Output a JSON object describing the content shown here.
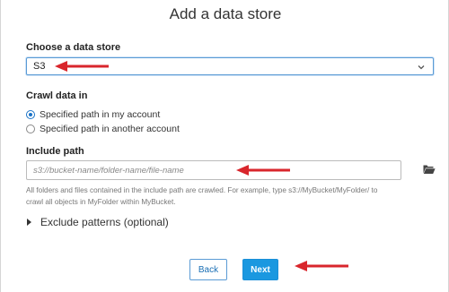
{
  "dialog": {
    "title": "Add a data store"
  },
  "data_store": {
    "label": "Choose a data store",
    "selected": "S3",
    "icons": {
      "dropdown": "chevron-down-icon"
    }
  },
  "crawl": {
    "label": "Crawl data in",
    "options": [
      {
        "label": "Specified path in my account",
        "checked": true
      },
      {
        "label": "Specified path in another account",
        "checked": false
      }
    ]
  },
  "include_path": {
    "label": "Include path",
    "placeholder": "s3://bucket-name/folder-name/file-name",
    "value": "",
    "help_line1": "All folders and files contained in the include path are crawled. For example, type s3://MyBucket/MyFolder/ to",
    "help_line2": "crawl all objects in MyFolder within MyBucket.",
    "icons": {
      "browse": "folder-open-icon"
    }
  },
  "exclude": {
    "label": "Exclude patterns (optional)",
    "icons": {
      "toggle": "caret-right-icon"
    }
  },
  "footer": {
    "back_label": "Back",
    "next_label": "Next"
  },
  "annotations": {
    "arrow_color": "#d9262c"
  },
  "colors": {
    "primary": "#1a98e0",
    "focus_border": "#5b9bd5",
    "link_text": "#1a6fb5"
  }
}
